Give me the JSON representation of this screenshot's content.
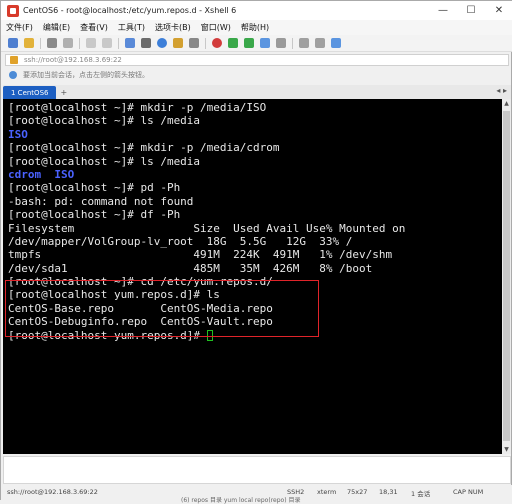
{
  "window": {
    "title": "CentOS6 - root@localhost:/etc/yum.repos.d - Xshell 6",
    "controls": {
      "minimize": "—",
      "maximize": "☐",
      "close": "✕"
    }
  },
  "menu": {
    "items": [
      "文件(F)",
      "编辑(E)",
      "查看(V)",
      "工具(T)",
      "选项卡(B)",
      "窗口(W)",
      "帮助(H)"
    ]
  },
  "address": {
    "text": "ssh://root@192.168.3.69:22"
  },
  "info": {
    "text": "要添加当前会话，点击左侧的箭头按钮。"
  },
  "tabs": {
    "active": "1 CentOS6",
    "add": "+",
    "nav": "◂ ▸"
  },
  "terminal": {
    "lines": [
      "[root@localhost ~]# mkdir -p /media/ISO",
      "[root@localhost ~]# ls /media",
      "ISO",
      "[root@localhost ~]# mkdir -p /media/cdrom",
      "[root@localhost ~]# ls /media",
      "cdrom  ISO",
      "[root@localhost ~]# pd -Ph",
      "-bash: pd: command not found",
      "[root@localhost ~]# df -Ph",
      "Filesystem                  Size  Used Avail Use% Mounted on",
      "/dev/mapper/VolGroup-lv_root  18G  5.5G   12G  33% /",
      "tmpfs                       491M  224K  491M   1% /dev/shm",
      "/dev/sda1                   485M   35M  426M   8% /boot",
      "[root@localhost ~]# cd /etc/yum.repos.d/",
      "[root@localhost yum.repos.d]# ls",
      "CentOS-Base.repo       CentOS-Media.repo",
      "CentOS-Debuginfo.repo  CentOS-Vault.repo",
      "[root@localhost yum.repos.d]# "
    ]
  },
  "status": {
    "session": "ssh://root@192.168.3.69:22",
    "protocol": "SSH2",
    "terminal": "xterm",
    "size": "75x27",
    "position": "18,31",
    "sessions": "1 会话",
    "caps": "CAP NUM"
  },
  "overlay": {
    "text": "(6) repos 目录 yum local repo(repo) 目录"
  },
  "colors": {
    "accent": "#1d5fc2",
    "terminal_bg": "#000000",
    "terminal_fg": "#e8e8e8",
    "dir": "#4a62ff",
    "highlight": "#e0242a",
    "cursor": "#20c020"
  }
}
